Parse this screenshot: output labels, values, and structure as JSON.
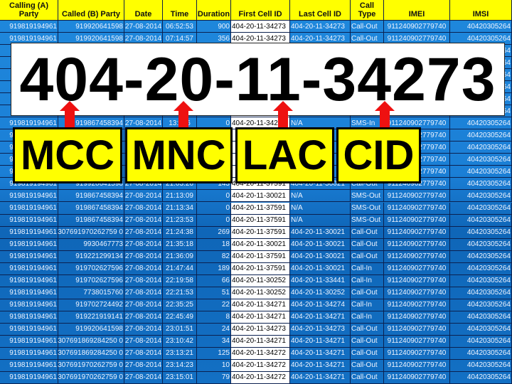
{
  "colors": {
    "header": "#ffff00",
    "row_blue": "#1b7fd6",
    "first_cell_bg": "#ffffff",
    "arrow": "#ee1111",
    "label_bg": "#ffff00"
  },
  "columns": [
    "Calling (A) Party",
    "Called (B) Party",
    "Date",
    "Time",
    "Duration",
    "First Cell ID",
    "Last Cell ID",
    "Call Type",
    "IMEI",
    "IMSI"
  ],
  "rows": [
    [
      "919819194961",
      "919920641598",
      "27-08-2014",
      "06:52:53",
      "900",
      "404-20-11-34273",
      "404-20-11-34273",
      "Call-Out",
      "911240902779740",
      "40420305264"
    ],
    [
      "919819194961",
      "919920641598",
      "27-08-2014",
      "07:14:57",
      "356",
      "404-20-11-34273",
      "404-20-11-34273",
      "Call-Out",
      "911240902779740",
      "40420305264"
    ],
    [
      "",
      "",
      "",
      "",
      "",
      "",
      "",
      "",
      "",
      "40420305264"
    ],
    [
      "",
      "",
      "",
      "",
      "",
      "",
      "",
      "",
      "",
      "40420305264"
    ],
    [
      "",
      "",
      "",
      "",
      "",
      "",
      "",
      "",
      "",
      "40420305264"
    ],
    [
      "",
      "",
      "",
      "",
      "",
      "",
      "",
      "",
      "",
      "40420305264"
    ],
    [
      "",
      "",
      "",
      "",
      "",
      "",
      "",
      "",
      "",
      "40420305264"
    ],
    [
      "",
      "",
      "",
      "",
      "",
      "",
      "",
      "",
      "",
      "40420305264"
    ],
    [
      "919819194961",
      "919867458394",
      "27-08-2014",
      "13:  :06",
      "0",
      "404-20-11-34273",
      "N/A",
      "SMS-In",
      "911240902779740",
      "40420305264"
    ],
    [
      "919819194961",
      "",
      "",
      "",
      "",
      "",
      "",
      "",
      "911240902779740",
      "40420305264"
    ],
    [
      "919819194961",
      "",
      "",
      "",
      "",
      "",
      "",
      "",
      "911240902779740",
      "40420305264"
    ],
    [
      "919819194961",
      "",
      "",
      "",
      "",
      "",
      "",
      "",
      "911240902779740",
      "40420305264"
    ],
    [
      "919819194961",
      "",
      "",
      "",
      "",
      "",
      "",
      "",
      "911240902779740",
      "40420305264"
    ],
    [
      "919819194961",
      "919920641598",
      "27-08-2014",
      "21:03:26",
      "143",
      "404-20-11-37591",
      "404-20-11-30021",
      "Call-Out",
      "911240902779740",
      "40420305264"
    ],
    [
      "919819194961",
      "919867458394",
      "27-08-2014",
      "21:13:09",
      "0",
      "404-20-11-30021",
      "N/A",
      "SMS-Out",
      "911240902779740",
      "40420305264"
    ],
    [
      "919819194961",
      "919867458394",
      "27-08-2014",
      "21:13:34",
      "0",
      "404-20-11-37591",
      "N/A",
      "SMS-Out",
      "911240902779740",
      "40420305264"
    ],
    [
      "919819194961",
      "919867458394",
      "27-08-2014",
      "21:23:53",
      "0",
      "404-20-11-37591",
      "N/A",
      "SMS-Out",
      "911240902779740",
      "40420305264"
    ],
    [
      "919819194961",
      "307691970262759 0",
      "27-08-2014",
      "21:24:38",
      "269",
      "404-20-11-37591",
      "404-20-11-30021",
      "Call-Out",
      "911240902779740",
      "40420305264"
    ],
    [
      "919819194961",
      "9930467773",
      "27-08-2014",
      "21:35:18",
      "18",
      "404-20-11-30021",
      "404-20-11-30021",
      "Call-Out",
      "911240902779740",
      "40420305264"
    ],
    [
      "919819194961",
      "919221299134",
      "27-08-2014",
      "21:36:09",
      "82",
      "404-20-11-37591",
      "404-20-11-30021",
      "Call-Out",
      "911240902779740",
      "40420305264"
    ],
    [
      "919819194961",
      "919702627596",
      "27-08-2014",
      "21:47:44",
      "189",
      "404-20-11-37591",
      "404-20-11-30021",
      "Call-In",
      "911240902779740",
      "40420305264"
    ],
    [
      "919819194961",
      "919702627596",
      "27-08-2014",
      "22:19:58",
      "66",
      "404-20-11-30252",
      "404-20-11-33441",
      "Call-In",
      "911240902779740",
      "40420305264"
    ],
    [
      "919819194961",
      "7738015760",
      "27-08-2014",
      "22:21:53",
      "51",
      "404-20-11-30252",
      "404-20-11-30252",
      "Call-Out",
      "911240902779740",
      "40420305264"
    ],
    [
      "919819194961",
      "919702724492",
      "27-08-2014",
      "22:35:25",
      "22",
      "404-20-11-34271",
      "404-20-11-34274",
      "Call-In",
      "911240902779740",
      "40420305264"
    ],
    [
      "919819194961",
      "919221919141",
      "27-08-2014",
      "22:45:49",
      "8",
      "404-20-11-34271",
      "404-20-11-34271",
      "Call-In",
      "911240902779740",
      "40420305264"
    ],
    [
      "919819194961",
      "919920641598",
      "27-08-2014",
      "23:01:51",
      "24",
      "404-20-11-34273",
      "404-20-11-34273",
      "Call-Out",
      "911240902779740",
      "40420305264"
    ],
    [
      "919819194961",
      "307691869284250 0",
      "27-08-2014",
      "23:10:42",
      "34",
      "404-20-11-34271",
      "404-20-11-34271",
      "Call-Out",
      "911240902779740",
      "40420305264"
    ],
    [
      "919819194961",
      "307691869284250 0",
      "27-08-2014",
      "23:13:21",
      "125",
      "404-20-11-34272",
      "404-20-11-34271",
      "Call-Out",
      "911240902779740",
      "40420305264"
    ],
    [
      "919819194961",
      "307691970262759 0",
      "27-08-2014",
      "23:14:23",
      "10",
      "404-20-11-34272",
      "404-20-11-34271",
      "Call-Out",
      "911240902779740",
      "40420305264"
    ],
    [
      "919819194961",
      "307691970262759 0",
      "27-08-2014",
      "23:15:01",
      "79",
      "404-20-11-34272",
      "404-20-11-34271",
      "Call-Out",
      "911240902779740",
      "40420305264"
    ]
  ],
  "overlay": {
    "cell_id": "404-20-11-34273",
    "labels": [
      "MCC",
      "MNC",
      "LAC",
      "CID"
    ]
  }
}
